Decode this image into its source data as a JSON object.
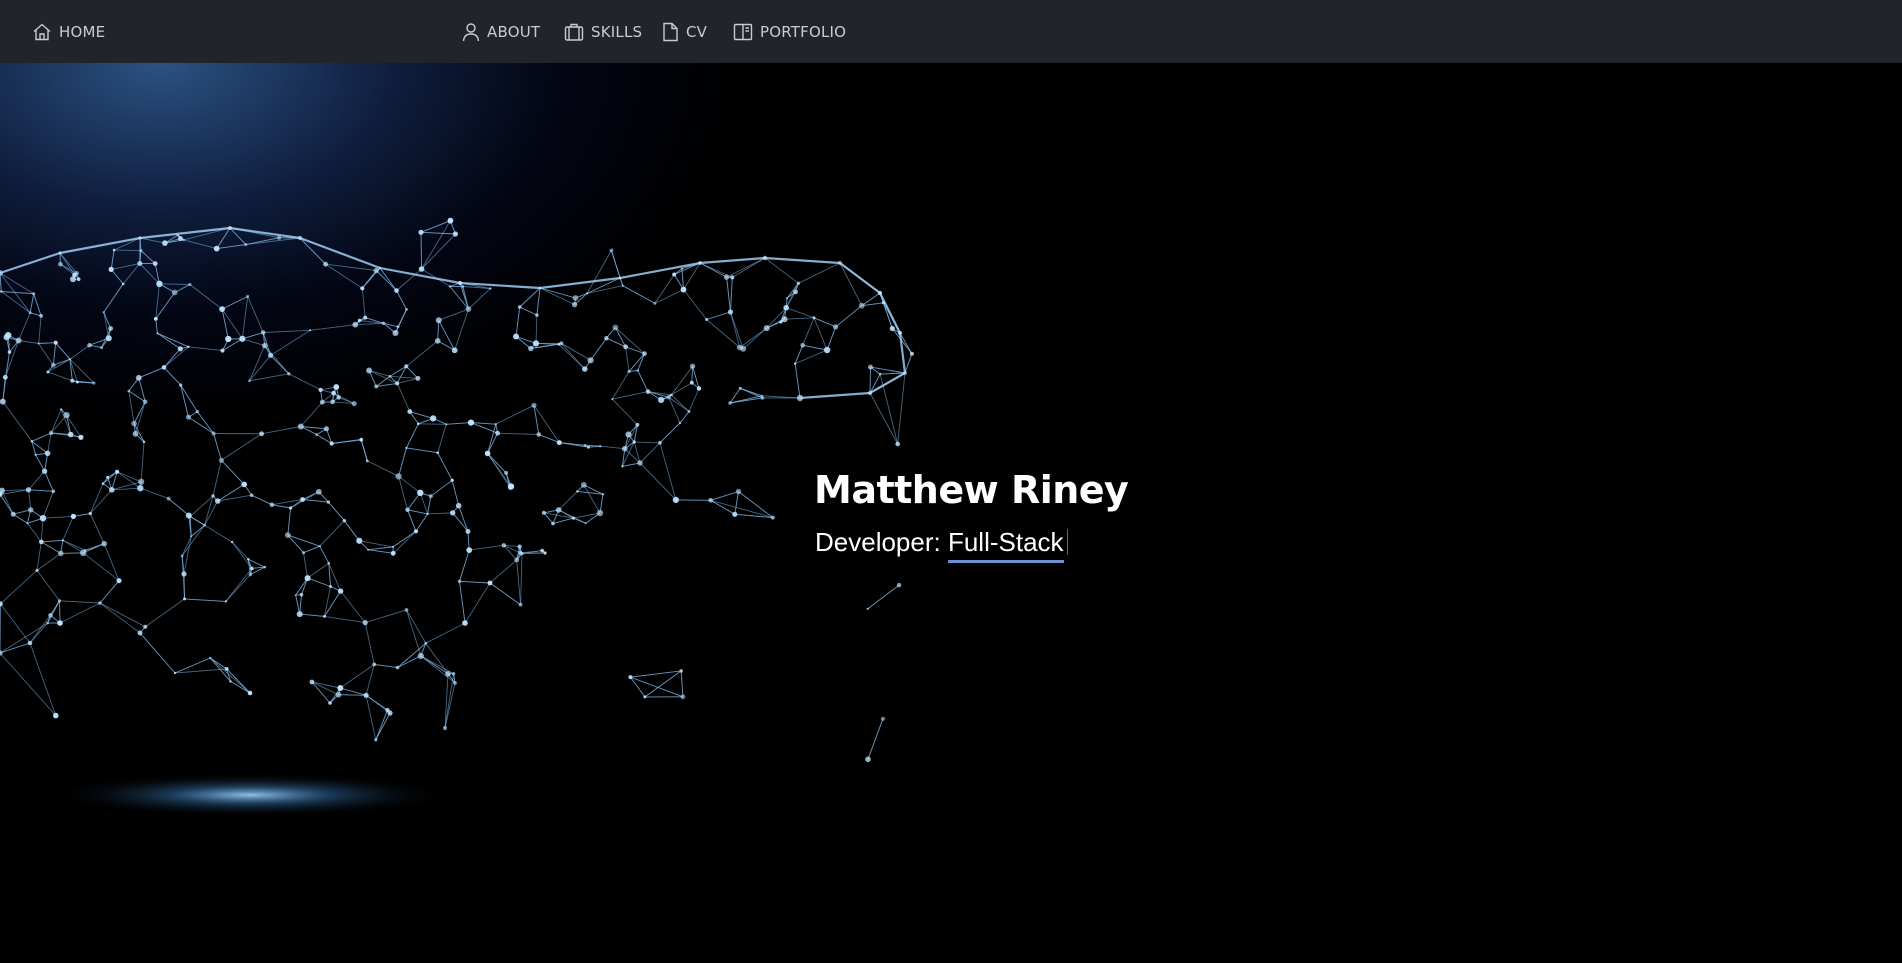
{
  "nav": {
    "home": {
      "label": "HOME",
      "icon": "home-icon"
    },
    "about": {
      "label": "ABOUT",
      "icon": "person-icon"
    },
    "skills": {
      "label": "SKILLS",
      "icon": "briefcase-icon"
    },
    "cv": {
      "label": "CV",
      "icon": "document-icon"
    },
    "portfolio": {
      "label": "PORTFOLIO",
      "icon": "book-icon"
    }
  },
  "hero": {
    "name": "Matthew Riney",
    "role_prefix": "Developer:",
    "role_typed": "Full-Stack",
    "background_image": "cheetah-network-icon"
  },
  "colors": {
    "navbar": "#212529",
    "nav_text": "#c9ccd0",
    "background": "#000000",
    "accent_underline": "#6d8fcf",
    "network_lines": "#7fb8e8"
  }
}
